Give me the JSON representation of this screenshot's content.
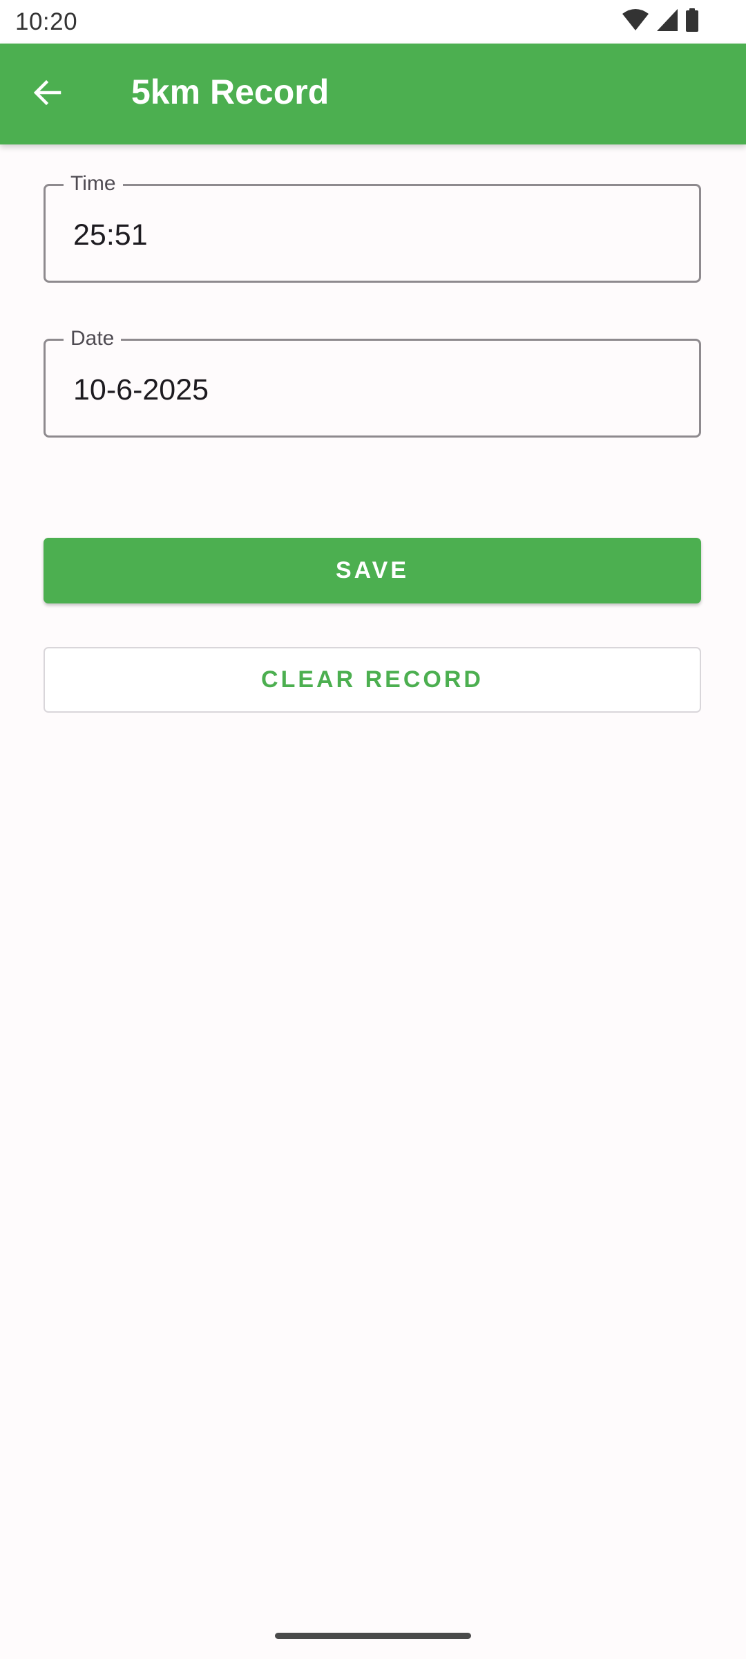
{
  "status_bar": {
    "time": "10:20",
    "icons": [
      "wifi-icon",
      "signal-icon",
      "battery-icon"
    ]
  },
  "app_bar": {
    "title": "5km Record",
    "back_icon": "arrow-back-icon",
    "color": "#4caf50"
  },
  "form": {
    "time_field": {
      "label": "Time",
      "value": "25:51"
    },
    "date_field": {
      "label": "Date",
      "value": "10-6-2025"
    }
  },
  "actions": {
    "save_label": "SAVE",
    "clear_label": "CLEAR RECORD"
  },
  "colors": {
    "accent": "#4caf50",
    "background": "#fefbfc",
    "outline": "#8e8a8e"
  }
}
